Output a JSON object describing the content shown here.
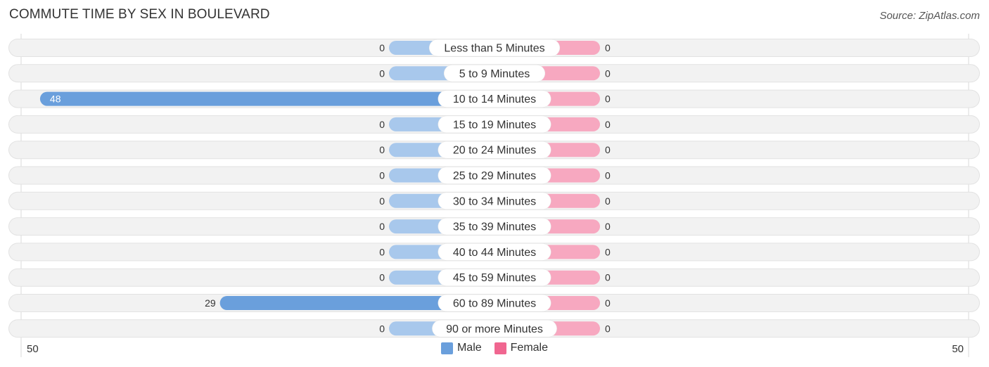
{
  "title": "COMMUTE TIME BY SEX IN BOULEVARD",
  "source": "Source: ZipAtlas.com",
  "colors": {
    "male": "#6a9fdc",
    "male_light": "#a8c8ec",
    "female": "#f06690",
    "female_light": "#f7a8c0",
    "row_bg": "#f2f2f2"
  },
  "legend": [
    {
      "label": "Male",
      "color": "#6a9fdc"
    },
    {
      "label": "Female",
      "color": "#f06690"
    }
  ],
  "axis": {
    "left_label": "50",
    "right_label": "50"
  },
  "chart_data": {
    "type": "bar",
    "orientation": "horizontal-diverging",
    "title": "COMMUTE TIME BY SEX IN BOULEVARD",
    "categories": [
      "Less than 5 Minutes",
      "5 to 9 Minutes",
      "10 to 14 Minutes",
      "15 to 19 Minutes",
      "20 to 24 Minutes",
      "25 to 29 Minutes",
      "30 to 34 Minutes",
      "35 to 39 Minutes",
      "40 to 44 Minutes",
      "45 to 59 Minutes",
      "60 to 89 Minutes",
      "90 or more Minutes"
    ],
    "series": [
      {
        "name": "Male",
        "values": [
          0,
          0,
          48,
          0,
          0,
          0,
          0,
          0,
          0,
          0,
          29,
          0
        ]
      },
      {
        "name": "Female",
        "values": [
          0,
          0,
          0,
          0,
          0,
          0,
          0,
          0,
          0,
          0,
          0,
          0
        ]
      }
    ],
    "xlim": [
      -50,
      50
    ],
    "xtick_labels": [
      "50",
      "50"
    ],
    "legend_position": "bottom-center",
    "grid": false
  }
}
